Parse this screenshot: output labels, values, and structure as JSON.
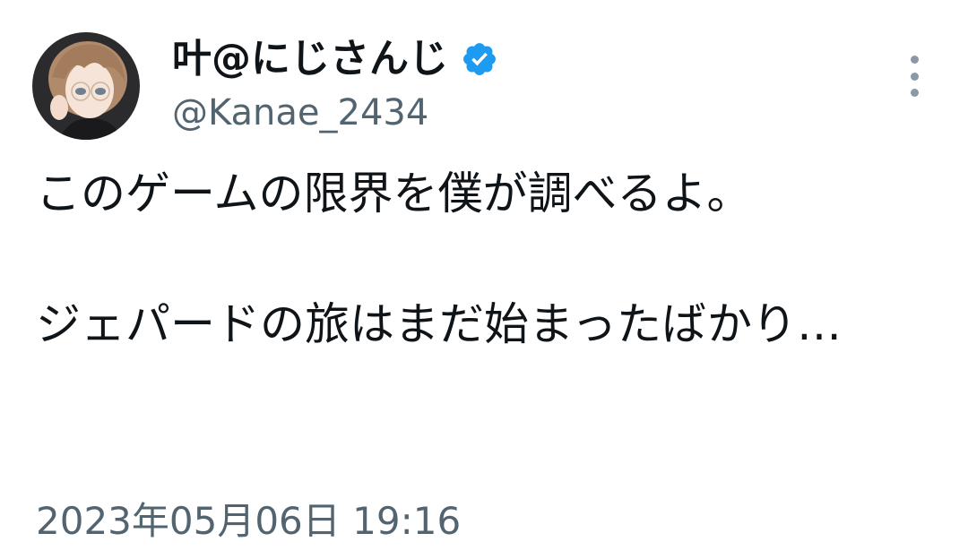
{
  "tweet": {
    "author": {
      "display_name": "叶@にじさんじ",
      "handle": "@Kanae_2434",
      "verified": true,
      "verified_color": "#1d9bf0"
    },
    "text": "このゲームの限界を僕が調べるよ。\n\nジェパードの旅はまだ始まったばかり…",
    "timestamp": "2023年05月06日 19:16"
  },
  "icons": {
    "avatar": "avatar-image",
    "verified": "verified-badge-icon",
    "more": "more-options-icon"
  }
}
